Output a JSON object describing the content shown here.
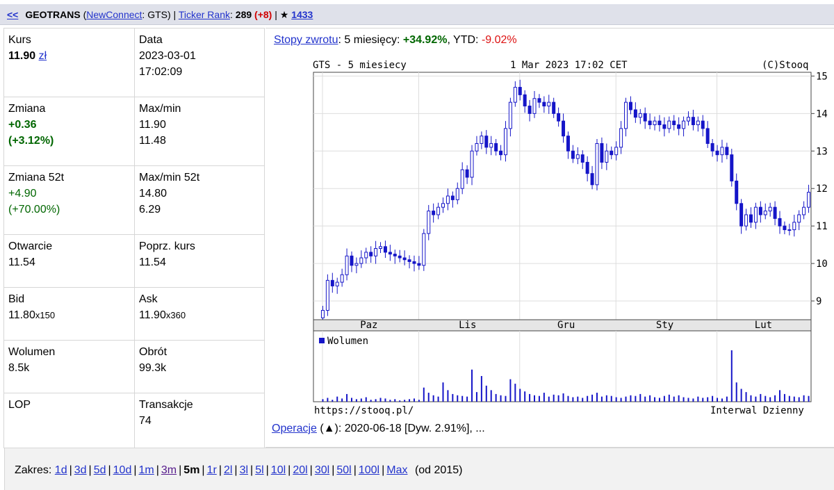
{
  "header": {
    "back_arrows": "<<",
    "name": "GEOTRANS",
    "open_paren": " (",
    "market_link": "NewConnect",
    "symbol": ": GTS)",
    "sep1": " | ",
    "ticker_rank_link": "Ticker Rank",
    "rank_label": ": ",
    "rank_value": "289",
    "rank_change": "(+8)",
    "sep2": " | ",
    "star": "★",
    "star_count": "1433"
  },
  "quote": {
    "price_label": "Kurs",
    "price_value": "11.90",
    "price_currency": "zł",
    "date_label": "Data",
    "date_value": "2023-03-01",
    "time_value": "17:02:09",
    "change_label": "Zmiana",
    "change_value": "+0.36",
    "change_pct": "(+3.12%)",
    "maxmin_label": "Max/min",
    "max_value": "11.90",
    "min_value": "11.48",
    "change52_label": "Zmiana 52t",
    "change52_value": "+4.90",
    "change52_pct": "(+70.00%)",
    "maxmin52_label": "Max/min 52t",
    "max52_value": "14.80",
    "min52_value": "6.29",
    "open_label": "Otwarcie",
    "open_value": "11.54",
    "prev_label": "Poprz. kurs",
    "prev_value": "11.54",
    "bid_label": "Bid",
    "bid_value": "11.80",
    "bid_size": "x150",
    "ask_label": "Ask",
    "ask_value": "11.90",
    "ask_size": "x360",
    "volume_label": "Wolumen",
    "volume_value": "8.5k",
    "turnover_label": "Obrót",
    "turnover_value": "99.3k",
    "lop_label": "LOP",
    "trans_label": "Transakcje",
    "trans_value": "74"
  },
  "returns": {
    "link": "Stopy zwrotu",
    "period": ": 5 miesięcy: ",
    "period_value": "+34.92%",
    "ytd_label": ", YTD: ",
    "ytd_value": "-9.02%"
  },
  "chart_data": {
    "type": "candlestick",
    "title_left": "GTS - 5 miesiecy",
    "title_center": "1 Mar 2023 17:02 CET",
    "title_right": "(C)Stooq",
    "y_ticks": [
      "15",
      "14",
      "13",
      "12",
      "11",
      "10",
      "9"
    ],
    "ylim": [
      8.5,
      15.1
    ],
    "month_labels": [
      "Paz",
      "Lis",
      "Gru",
      "Sty",
      "Lut"
    ],
    "volume_label": "Wolumen",
    "footer_left": "https://stooq.pl/",
    "footer_right": "Interwal Dzienny",
    "candle_color": "#1515c8",
    "close": [
      8.75,
      9.55,
      9.4,
      9.5,
      9.7,
      10.2,
      9.95,
      10.0,
      10.15,
      10.3,
      10.2,
      10.4,
      10.45,
      10.3,
      10.25,
      10.2,
      10.15,
      10.1,
      10.05,
      10.0,
      9.95,
      10.8,
      11.4,
      11.3,
      11.5,
      11.6,
      11.8,
      11.7,
      12.0,
      12.5,
      12.3,
      13.0,
      13.2,
      13.4,
      13.1,
      13.2,
      13.0,
      12.9,
      13.6,
      14.3,
      14.7,
      14.5,
      14.2,
      14.0,
      14.4,
      14.3,
      14.2,
      14.3,
      14.0,
      13.8,
      13.4,
      13.0,
      12.8,
      12.9,
      12.7,
      12.4,
      12.1,
      13.2,
      12.7,
      13.0,
      12.9,
      13.1,
      13.6,
      14.3,
      14.1,
      13.9,
      14.0,
      13.8,
      13.7,
      13.8,
      13.7,
      13.6,
      13.8,
      13.7,
      13.6,
      13.8,
      13.9,
      13.7,
      13.8,
      13.6,
      13.2,
      13.0,
      12.9,
      13.1,
      12.9,
      12.2,
      11.6,
      11.0,
      11.3,
      11.1,
      11.5,
      11.3,
      11.4,
      11.5,
      11.2,
      11.0,
      10.9,
      10.9,
      11.1,
      11.3,
      11.5,
      11.9
    ],
    "volume": [
      4,
      6,
      3,
      8,
      5,
      12,
      6,
      4,
      5,
      7,
      3,
      4,
      6,
      5,
      3,
      4,
      2,
      3,
      4,
      5,
      3,
      22,
      14,
      10,
      8,
      30,
      18,
      12,
      10,
      9,
      8,
      50,
      15,
      40,
      25,
      18,
      12,
      10,
      9,
      35,
      28,
      20,
      16,
      12,
      10,
      9,
      14,
      8,
      11,
      10,
      13,
      9,
      7,
      8,
      6,
      9,
      11,
      14,
      8,
      10,
      9,
      7,
      6,
      8,
      10,
      9,
      12,
      8,
      10,
      7,
      6,
      9,
      11,
      8,
      10,
      7,
      6,
      5,
      8,
      6,
      7,
      9,
      6,
      5,
      8,
      80,
      30,
      20,
      15,
      10,
      8,
      12,
      9,
      7,
      10,
      18,
      12,
      9,
      8,
      7,
      10,
      9
    ]
  },
  "ops": {
    "link": "Operacje",
    "arrow": " (▲)",
    "text": ": 2020-06-18 [Dyw. 2.91%], ..."
  },
  "range": {
    "label": "Zakres: ",
    "items": [
      "1d",
      "3d",
      "5d",
      "10d",
      "1m",
      "3m",
      "5m",
      "1r",
      "2l",
      "3l",
      "5l",
      "10l",
      "20l",
      "30l",
      "50l",
      "100l",
      "Max"
    ],
    "suffix": " (od 2015)"
  }
}
